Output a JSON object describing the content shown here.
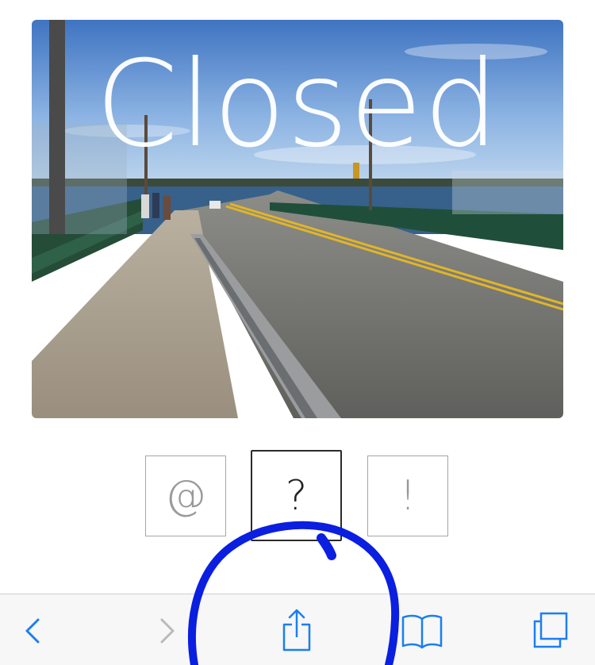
{
  "photo": {
    "caption": "Closed",
    "description_icon": "bridge-photo"
  },
  "options": [
    {
      "label": "@",
      "selected": false
    },
    {
      "label": "?",
      "selected": true
    },
    {
      "label": "!",
      "selected": false
    }
  ],
  "toolbar": {
    "icons": [
      "back-icon",
      "forward-icon",
      "share-icon",
      "bookmarks-icon",
      "tabs-icon"
    ],
    "accent_color": "#1a7ff2",
    "disabled_color": "#b9b9be"
  },
  "annotation": {
    "shape": "hand-drawn-circle",
    "color": "#0a1fe0"
  }
}
